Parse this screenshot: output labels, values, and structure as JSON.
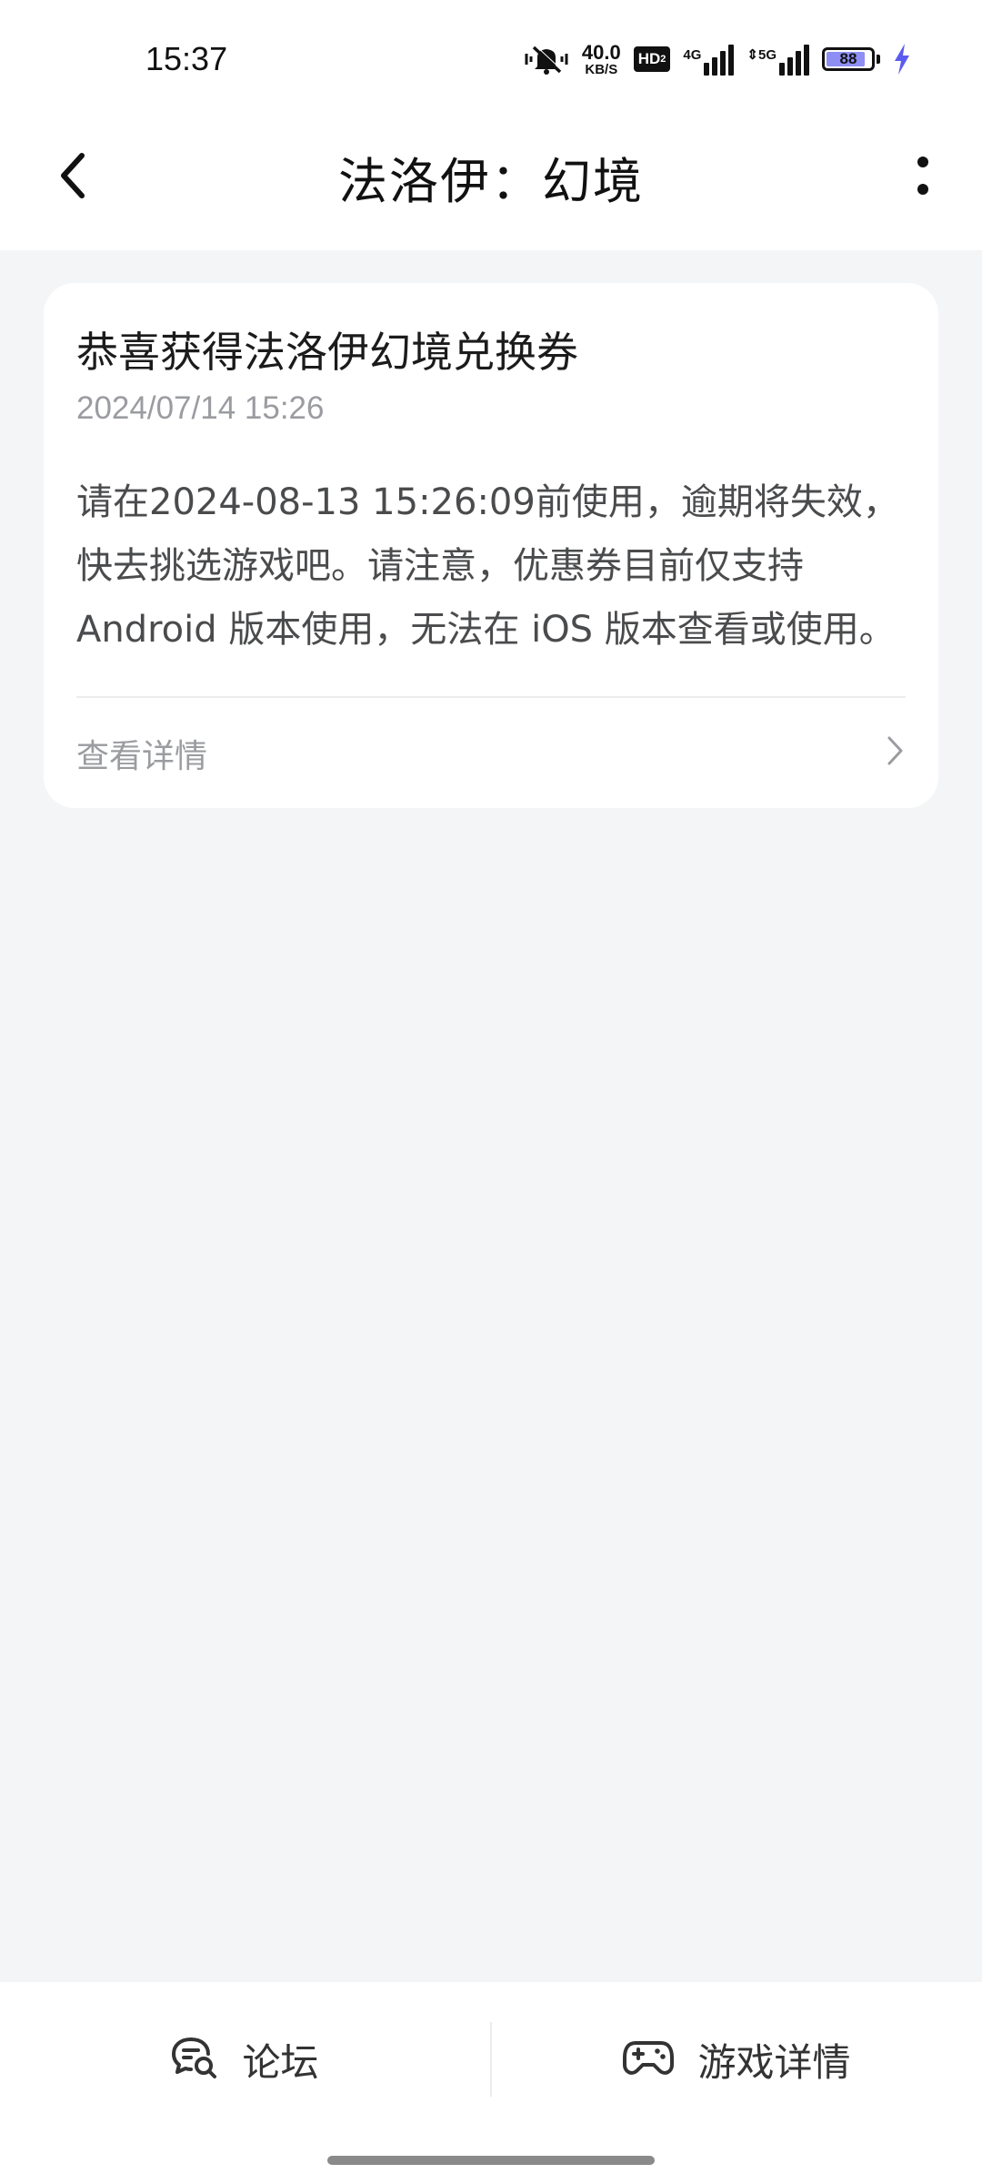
{
  "status_bar": {
    "time": "15:37",
    "net_speed_value": "40.0",
    "net_speed_unit": "KB/S",
    "hd_badge": "HD",
    "hd_badge_sub": "2",
    "signal1_label": "4G",
    "signal2_label": "5G",
    "battery_level": "88",
    "battery_fraction": 0.88,
    "battery_color": "#8e8ef4",
    "charging_color": "#5b5bf0",
    "icons": [
      "mute-vibrate-icon",
      "signal-4g-icon",
      "signal-5g-icon",
      "battery-icon",
      "charging-icon"
    ]
  },
  "nav": {
    "title": "法洛伊：幻境",
    "back_icon": "back-arrow-icon",
    "more_icon": "more-vertical-icon"
  },
  "message": {
    "title": "恭喜获得法洛伊幻境兑换券",
    "date": "2024/07/14 15:26",
    "body_lines": [
      "请在2024-08-13 15:26:09前使用，逾期将失效，",
      "快去挑选游戏吧。请注意，优惠券目前仅支持",
      "Android 版本使用，无法在 iOS 版本查看或使用。"
    ],
    "link_label": "查看详情",
    "link_icon": "chevron-right-icon"
  },
  "bottom_bar": {
    "forum_label": "论坛",
    "forum_icon": "forum-chat-icon",
    "game_detail_label": "游戏详情",
    "game_detail_icon": "gamepad-icon"
  },
  "colors": {
    "page_background": "#f4f5f7",
    "card_background": "#ffffff",
    "secondary_text": "#9a9ca0"
  }
}
